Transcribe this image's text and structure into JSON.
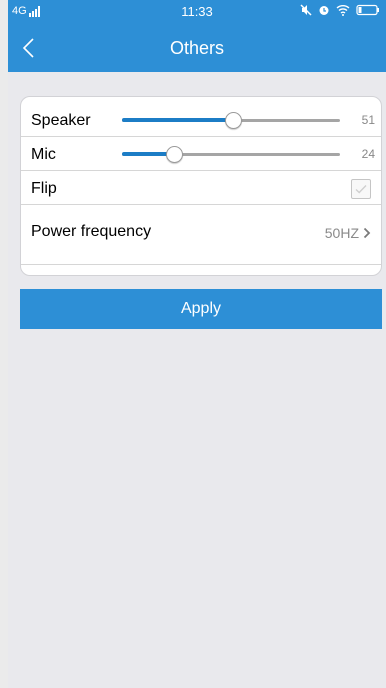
{
  "status_bar": {
    "network": "4G",
    "time": "11:33",
    "icons": [
      "signal-icon",
      "mute-icon",
      "alarm-icon",
      "wifi-icon",
      "battery-icon"
    ]
  },
  "navbar": {
    "title": "Others",
    "back_icon": "chevron-left-icon"
  },
  "settings": {
    "speaker": {
      "label": "Speaker",
      "value": "51",
      "level": 51
    },
    "mic": {
      "label": "Mic",
      "value": "24",
      "level": 24
    },
    "flip": {
      "label": "Flip",
      "checked": false
    },
    "power_frequency": {
      "label": "Power frequency",
      "value": "50HZ",
      "icon": "chevron-right-icon"
    }
  },
  "apply_label": "Apply",
  "colors": {
    "accent": "#2d8fd6",
    "slider_fill": "#1c7dc6",
    "background": "#e9e9ed"
  }
}
